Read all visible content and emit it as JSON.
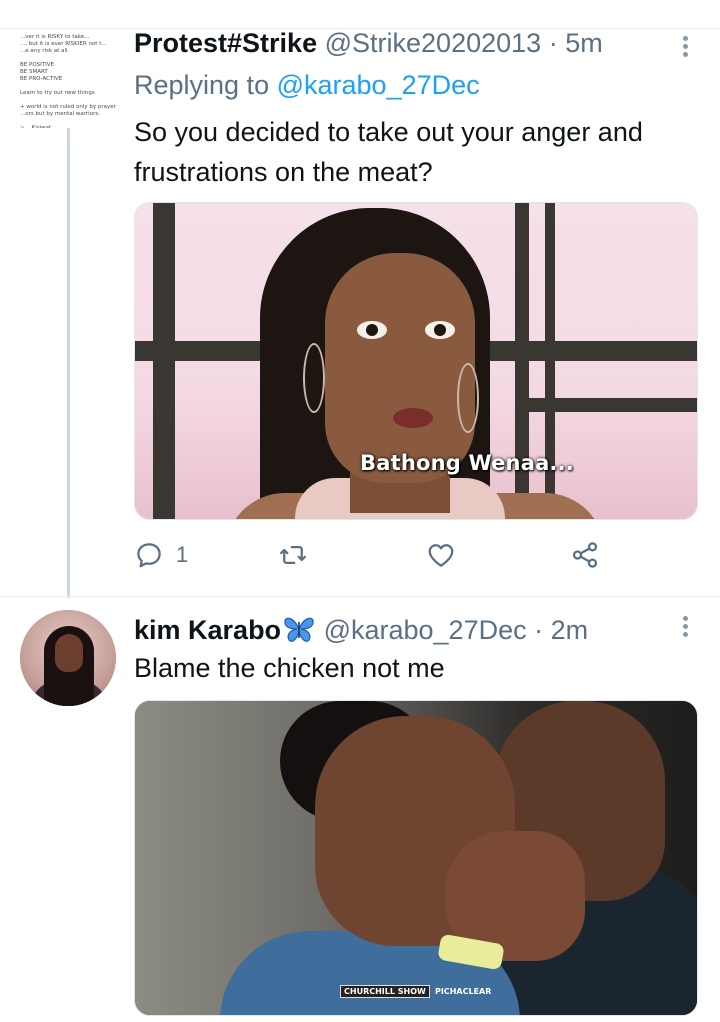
{
  "tweets": [
    {
      "display_name": "Protest#Strike",
      "handle": "@Strike20202013",
      "separator": "·",
      "time": "5m",
      "replying_prefix": "Replying to",
      "replying_to": "@karabo_27Dec",
      "text_line1": "So you decided to take out your anger and",
      "text_line2": "frustrations on the meat?",
      "avatar_quote": [
        "...ver it is RISKY to take...",
        "..., but it is ever RISKIER not t...",
        "...e any risk at all.",
        "",
        "BE POSITIVE",
        "BE SMART",
        "BE PRO-ACTIVE",
        "",
        "Learn to try out new things",
        "",
        "+ world is not ruled only by prayer",
        "...ors but by mental warriors.",
        "",
        "~ ...Kisiwat..."
      ],
      "media_caption": "Bathong Wenaa...",
      "reply_count": "1"
    },
    {
      "display_name": "kim Karabo",
      "handle": "@karabo_27Dec",
      "separator": "·",
      "time": "2m",
      "text_line1": "Blame the chicken not me",
      "watermark_left": "CHURCHILL SHOW",
      "watermark_right": "PICHACLEAR"
    }
  ],
  "icons": {
    "reply": "reply-icon",
    "retweet": "retweet-icon",
    "like": "heart-icon",
    "share": "share-icon",
    "more": "more-icon",
    "name_emoji": "butterfly-icon"
  },
  "colors": {
    "handle_gray": "#5b7083",
    "mention_blue": "#1da1f2",
    "icon_gray": "#5b7083",
    "butterfly_blue": "#3d8be0"
  }
}
